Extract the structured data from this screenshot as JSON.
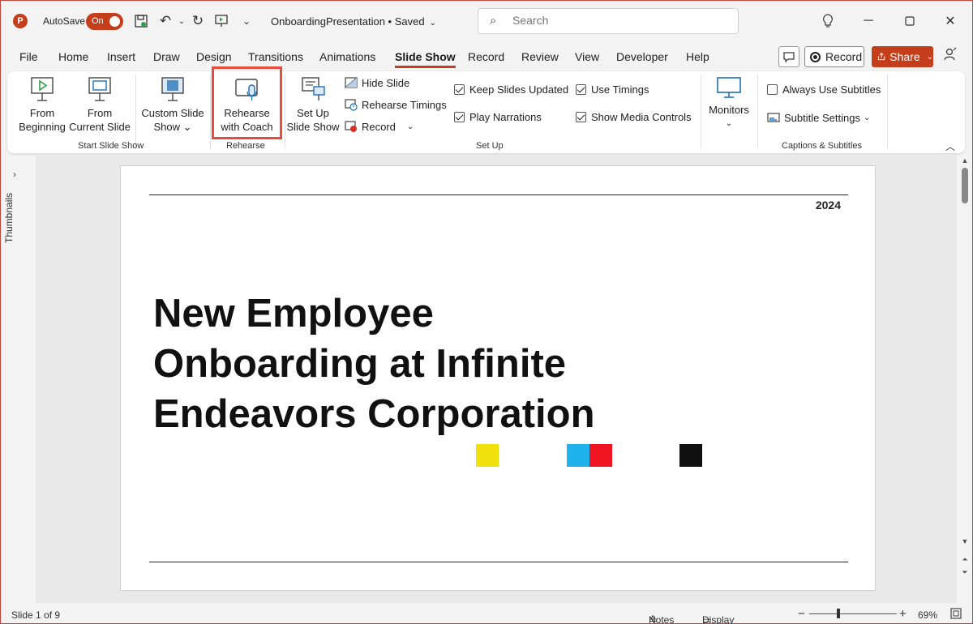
{
  "titlebar": {
    "autosave_label": "AutoSave",
    "autosave_state": "On",
    "doc_title": "OnboardingPresentation • Saved",
    "search_placeholder": "Search"
  },
  "tabs": [
    "File",
    "Home",
    "Insert",
    "Draw",
    "Design",
    "Transitions",
    "Animations",
    "Slide Show",
    "Record",
    "Review",
    "View",
    "Developer",
    "Help"
  ],
  "active_tab": "Slide Show",
  "actions": {
    "record_label": "Record",
    "share_label": "Share"
  },
  "ribbon": {
    "start_group": {
      "label": "Start Slide Show",
      "from_beginning": [
        "From",
        "Beginning"
      ],
      "from_current": [
        "From",
        "Current Slide"
      ],
      "custom": [
        "Custom Slide",
        "Show ⌄"
      ]
    },
    "rehearse_group": {
      "label": "Rehearse",
      "rehearse_coach": [
        "Rehearse",
        "with Coach"
      ]
    },
    "setup_group": {
      "label": "Set Up",
      "setup_show": [
        "Set Up",
        "Slide Show"
      ],
      "hide_slide": "Hide Slide",
      "rehearse_timings": "Rehearse Timings",
      "record": "Record",
      "keep_updated": "Keep Slides Updated",
      "play_narrations": "Play Narrations",
      "use_timings": "Use Timings",
      "show_media": "Show Media Controls"
    },
    "monitors_group": {
      "monitors": "Monitors"
    },
    "captions_group": {
      "label": "Captions & Subtitles",
      "always_subtitles": "Always Use Subtitles",
      "subtitle_settings": "Subtitle Settings"
    }
  },
  "sidebar": {
    "thumbnails_label": "Thumbnails"
  },
  "slide": {
    "year": "2024",
    "title_lines": [
      "New Employee",
      "Onboarding at Infinite",
      "Endeavors Corporation"
    ],
    "square_colors": [
      "#f0e00c",
      "#1fb2ec",
      "#ef1520",
      "#111111"
    ]
  },
  "status": {
    "slide_info": "Slide 1 of 9",
    "notes": "Notes",
    "display_settings": "Display Settings",
    "zoom_minus": "−",
    "zoom_plus": "+",
    "zoom": "69%"
  },
  "colors": {
    "accent": "#c43e1c",
    "highlight": "#e74c3c"
  }
}
